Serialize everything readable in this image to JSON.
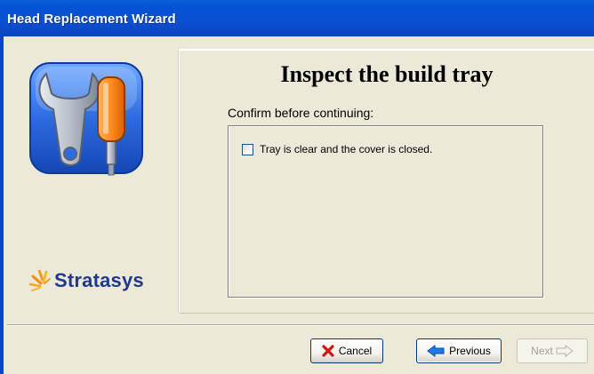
{
  "window": {
    "title": "Head Replacement Wizard"
  },
  "sidebar": {
    "icon": "wrench-screwdriver-icon",
    "brand": "Stratasys",
    "brand_color": "#1f3a8c"
  },
  "page": {
    "heading": "Inspect the build tray",
    "prompt": "Confirm before continuing:",
    "checkbox": {
      "label": "Tray is clear and the cover is closed.",
      "checked": false
    }
  },
  "buttons": {
    "cancel": {
      "label": "Cancel",
      "icon": "red-x-icon"
    },
    "previous": {
      "label": "Previous",
      "icon": "blue-left-arrow-icon"
    },
    "next": {
      "label": "Next",
      "icon": "right-arrow-outline-icon",
      "enabled": false
    }
  },
  "colors": {
    "titlebar": "#0553d6",
    "dialog_bg": "#ece9d8"
  }
}
